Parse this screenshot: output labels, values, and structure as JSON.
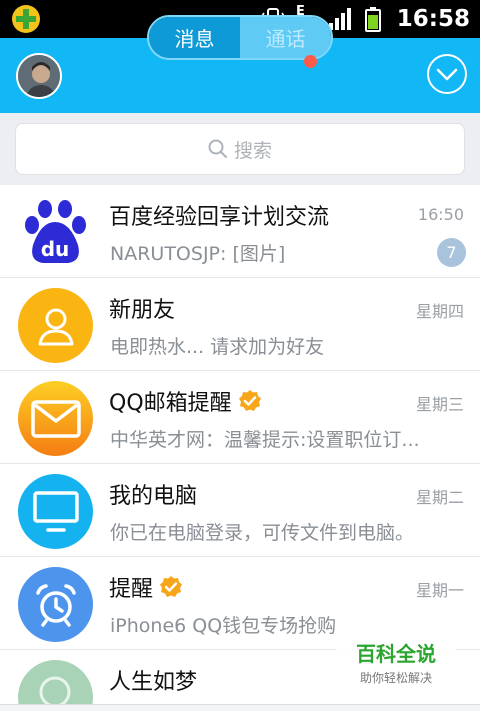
{
  "status_bar": {
    "time": "16:58",
    "icons": [
      "app-plus-icon",
      "vibrate-icon",
      "data-transfer-icon",
      "signal-icon",
      "battery-icon"
    ],
    "data_indicator": "E"
  },
  "header": {
    "tabs": [
      {
        "label": "消息",
        "active": true
      },
      {
        "label": "通话",
        "active": false
      }
    ],
    "accent_color": "#12b7f5",
    "notification_dot_color": "#ff5a4a"
  },
  "search": {
    "placeholder": "搜索"
  },
  "conversations": [
    {
      "name": "百度经验回享计划交流",
      "time": "16:50",
      "message": "NARUTOSJP: [图片]",
      "unread": "7",
      "icon": "baidu-logo-icon",
      "verified": false
    },
    {
      "name": "新朋友",
      "time": "星期四",
      "message": "电即热水... 请求加为好友",
      "icon": "contact-icon",
      "verified": false
    },
    {
      "name": "QQ邮箱提醒",
      "time": "星期三",
      "message": "中华英才网：温馨提示:设置职位订...",
      "icon": "mail-icon",
      "verified": true
    },
    {
      "name": "我的电脑",
      "time": "星期二",
      "message": "你已在电脑登录，可传文件到电脑。",
      "icon": "monitor-icon",
      "verified": false
    },
    {
      "name": "提醒",
      "time": "星期一",
      "message": "iPhone6 QQ钱包专场抢购",
      "icon": "alarm-clock-icon",
      "verified": true
    },
    {
      "name": "人生如梦",
      "time": "",
      "message": "",
      "icon": "avatar",
      "verified": false
    }
  ],
  "watermark": {
    "title": "百科全说",
    "subtitle": "助你轻松解决"
  }
}
